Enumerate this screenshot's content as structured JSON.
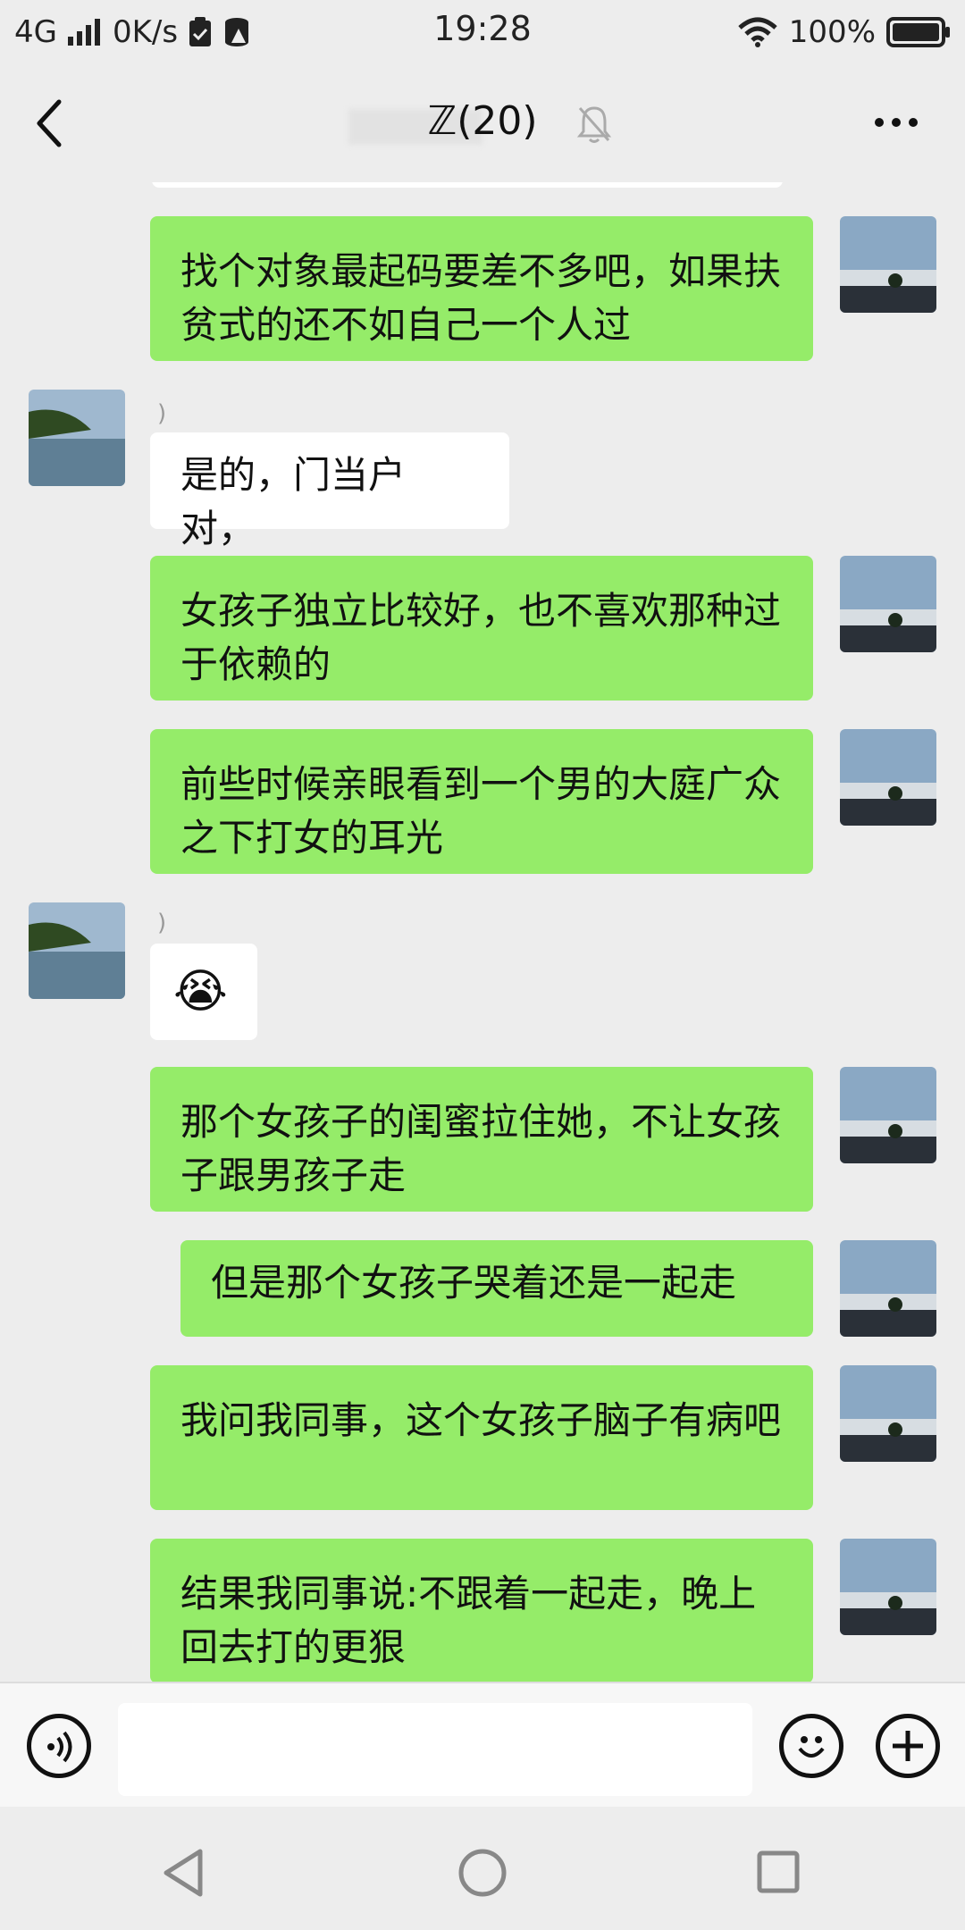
{
  "status_bar": {
    "network": "4G",
    "speed": "0K/s",
    "time": "19:28",
    "battery": "100%"
  },
  "header": {
    "title": "ℤ(20)",
    "back_icon": "chevron-left-icon",
    "mute_icon": "bell-off-icon",
    "more_icon": "more-horizontal-icon"
  },
  "messages": [
    {
      "side": "me",
      "text": "找个对象最起码要差不多吧，如果扶贫式的还不如自己一个人过"
    },
    {
      "side": "other",
      "nick": ")",
      "text": "是的，门当户对，"
    },
    {
      "side": "me",
      "text": "女孩子独立比较好，也不喜欢那种过于依赖的"
    },
    {
      "side": "me",
      "text": "前些时候亲眼看到一个男的大庭广众之下打女的耳光"
    },
    {
      "side": "other",
      "nick": ")",
      "emoji": "😭"
    },
    {
      "side": "me",
      "text": "那个女孩子的闺蜜拉住她，不让女孩子跟男孩子走"
    },
    {
      "side": "me",
      "text": "但是那个女孩子哭着还是一起走"
    },
    {
      "side": "me",
      "text": "我问我同事，这个女孩子脑子有病吧"
    },
    {
      "side": "me",
      "text": "结果我同事说:不跟着一起走，晚上回去打的更狠"
    }
  ],
  "input_bar": {
    "voice_icon": "voice-icon",
    "emoji_icon": "smiley-icon",
    "plus_icon": "plus-icon",
    "placeholder": ""
  },
  "colors": {
    "background": "#ededed",
    "my_bubble": "#95ec69",
    "other_bubble": "#ffffff"
  }
}
